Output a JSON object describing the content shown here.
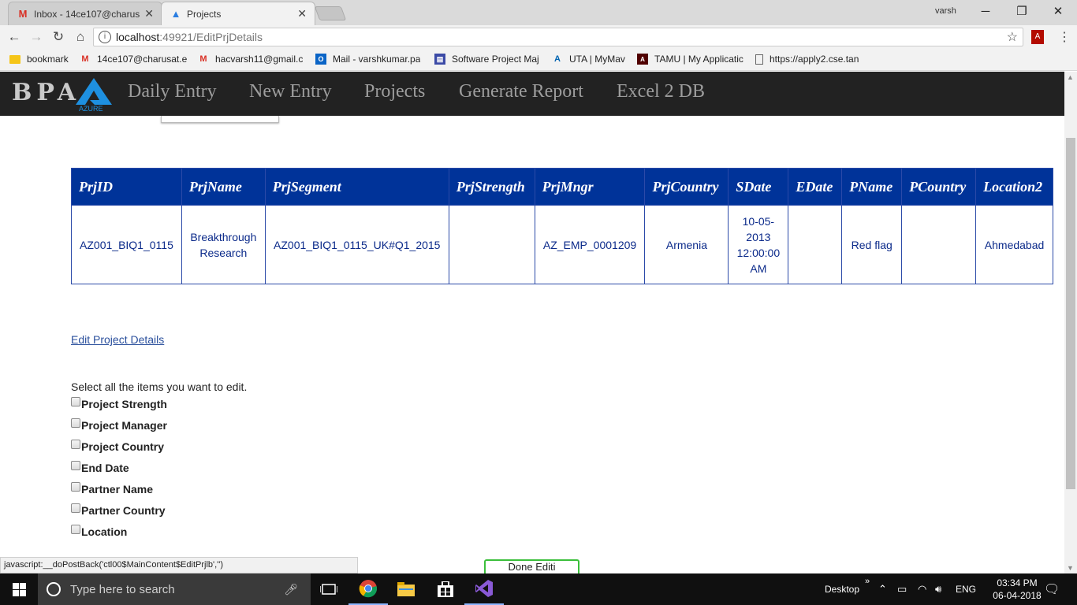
{
  "browser": {
    "tabs": [
      {
        "title": "Inbox - 14ce107@charus",
        "icon": "gmail-icon"
      },
      {
        "title": "Projects",
        "icon": "azure-icon"
      }
    ],
    "user": "varsh",
    "url_host": "localhost",
    "url_path": ":49921/EditPrjDetails",
    "bookmarks": [
      {
        "label": "bookmark",
        "icon": "folder-icon"
      },
      {
        "label": "14ce107@charusat.e",
        "icon": "gmail-icon"
      },
      {
        "label": "hacvarsh11@gmail.c",
        "icon": "gmail-icon"
      },
      {
        "label": "Mail - varshkumar.pa",
        "icon": "outlook-icon"
      },
      {
        "label": "Software Project Maj",
        "icon": "sheet-icon"
      },
      {
        "label": "UTA | MyMav",
        "icon": "uta-icon"
      },
      {
        "label": "TAMU | My Applicatic",
        "icon": "tamu-icon"
      },
      {
        "label": "https://apply2.cse.tan",
        "icon": "page-icon"
      }
    ]
  },
  "app": {
    "brand": "BPA",
    "logo_text": "AZURE",
    "nav": [
      "Daily Entry",
      "New Entry",
      "Projects",
      "Generate Report",
      "Excel 2 DB"
    ]
  },
  "table": {
    "headers": [
      "PrjID",
      "PrjName",
      "PrjSegment",
      "PrjStrength",
      "PrjMngr",
      "PrjCountry",
      "SDate",
      "EDate",
      "PName",
      "PCountry",
      "Location2"
    ],
    "rows": [
      [
        "AZ001_BIQ1_0115",
        "Breakthrough Research",
        "AZ001_BIQ1_0115_UK#Q1_2015",
        "",
        "AZ_EMP_0001209",
        "Armenia",
        "10-05-2013 12:00:00 AM",
        "",
        "Red flag",
        "",
        "Ahmedabad"
      ]
    ]
  },
  "edit_link": "Edit Project Details",
  "select_label": "Select all the items you want to edit.",
  "options": [
    "Project Strength",
    "Project Manager",
    "Project Country",
    "End Date",
    "Partner Name",
    "Partner Country",
    "Location"
  ],
  "status_bar": "javascript:__doPostBack('ctl00$MainContent$EditPrjlb','')",
  "done_button": "Done Editi",
  "taskbar": {
    "search_placeholder": "Type here to search",
    "desktop_label": "Desktop",
    "lang": "ENG",
    "time": "03:34 PM",
    "date": "06-04-2018"
  },
  "colors": {
    "header_bg": "#003399",
    "nav_bg": "#222222",
    "cell_text": "#0b2a8a"
  }
}
